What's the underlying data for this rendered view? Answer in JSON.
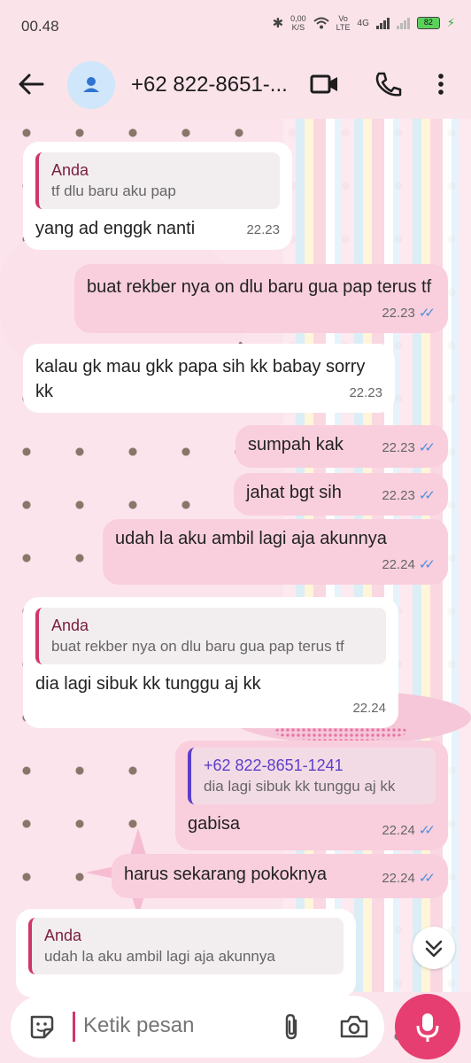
{
  "status_bar": {
    "time": "00.48",
    "net_speed_value": "0,00",
    "net_speed_unit": "K/S",
    "volte_top": "Vo",
    "volte_bottom": "LTE",
    "network": "4G",
    "battery": "82"
  },
  "header": {
    "contact_name": "+62 822-8651-..."
  },
  "messages": [
    {
      "direction": "incoming",
      "quote": {
        "author": "Anda",
        "text": "tf dlu baru aku pap"
      },
      "text": "yang ad enggk nanti",
      "time": "22.23"
    },
    {
      "direction": "outgoing",
      "text": "buat rekber nya on dlu baru gua pap terus tf",
      "time": "22.23"
    },
    {
      "direction": "incoming",
      "text": "kalau gk mau gkk papa sih kk babay sorry kk",
      "time": "22.23"
    },
    {
      "direction": "outgoing",
      "text": "sumpah kak",
      "time": "22.23"
    },
    {
      "direction": "outgoing",
      "text": "jahat bgt sih",
      "time": "22.23"
    },
    {
      "direction": "outgoing",
      "text": "udah la aku ambil lagi aja akunnya",
      "time": "22.24"
    },
    {
      "direction": "incoming",
      "quote": {
        "author": "Anda",
        "text": "buat rekber nya on dlu baru gua pap terus tf"
      },
      "text": "dia lagi sibuk kk tunggu aj kk",
      "time": "22.24"
    },
    {
      "direction": "outgoing",
      "quote": {
        "author": "+62 822-8651-1241",
        "text": "dia lagi sibuk kk tunggu aj kk"
      },
      "text": "gabisa",
      "time": "22.24"
    },
    {
      "direction": "outgoing",
      "text": "harus sekarang pokoknya",
      "time": "22.24"
    },
    {
      "direction": "incoming",
      "quote": {
        "author": "Anda",
        "text": "udah la aku ambil lagi aja akunnya"
      },
      "text": "",
      "time": ""
    }
  ],
  "input": {
    "placeholder": "Ketik pesan"
  },
  "colors": {
    "accent": "#e63e70",
    "outgoing_bubble": "#f9cfdd",
    "incoming_bubble": "#ffffff",
    "read_tick": "#4a90e2",
    "quote_bar": "#d0356b"
  },
  "icons": {
    "back": "back-arrow-icon",
    "avatar": "person-icon",
    "video": "video-call-icon",
    "call": "phone-icon",
    "menu": "more-vertical-icon",
    "scroll": "chevron-double-down-icon",
    "emoji": "sticker-icon",
    "attach": "paperclip-icon",
    "camera": "camera-icon",
    "mic": "microphone-icon",
    "read": "double-check-icon"
  }
}
